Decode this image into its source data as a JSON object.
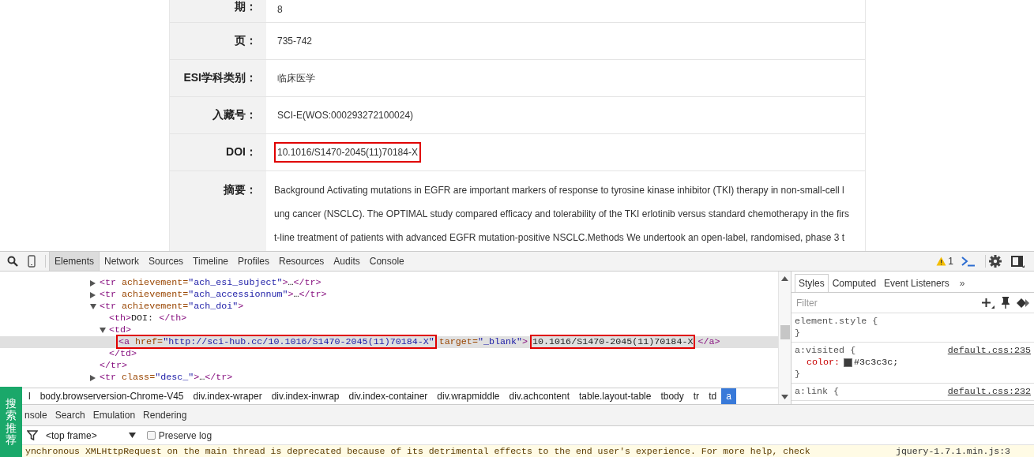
{
  "page": {
    "rows": [
      {
        "kind": "text",
        "label": "期：",
        "value": "8",
        "highlighted": false
      },
      {
        "kind": "text",
        "label": "页：",
        "value": "735-742",
        "highlighted": false
      },
      {
        "kind": "text",
        "label": "ESI学科类别：",
        "value": "临床医学",
        "highlighted": false
      },
      {
        "kind": "text",
        "label": "入藏号：",
        "value": "SCI-E(WOS:000293272100024)",
        "highlighted": false
      },
      {
        "kind": "text",
        "label": "DOI：",
        "value": "10.1016/S1470-2045(11)70184-X",
        "highlighted": true
      },
      {
        "kind": "paragraph",
        "label": "摘要：",
        "lines": [
          "Background Activating mutations in EGFR are important markers of response to tyrosine kinase inhibitor (TKI) therapy in non-small-cell l",
          "ung cancer (NSCLC). The OPTIMAL study compared efficacy and tolerability of the TKI erlotinib versus standard chemotherapy in the firs",
          "t-line treatment of patients with advanced EGFR mutation-positive NSCLC.Methods We undertook an open-label, randomised, phase 3 t"
        ]
      }
    ]
  },
  "devtools": {
    "tabs": [
      {
        "label": "Elements",
        "selected": true
      },
      {
        "label": "Network",
        "selected": false
      },
      {
        "label": "Sources",
        "selected": false
      },
      {
        "label": "Timeline",
        "selected": false
      },
      {
        "label": "Profiles",
        "selected": false
      },
      {
        "label": "Resources",
        "selected": false
      },
      {
        "label": "Audits",
        "selected": false
      },
      {
        "label": "Console",
        "selected": false
      }
    ],
    "warning_count": "1",
    "dom_tree": [
      {
        "selected": false,
        "expanded": false,
        "segments": [
          {
            "highlighted": false,
            "tokens": [
              {
                "kind": "tag",
                "text": "<tr "
              },
              {
                "kind": "attr",
                "text": "achievement="
              },
              {
                "kind": "value",
                "text": "\"ach_esi_subject\""
              },
              {
                "kind": "tag",
                "text": ">"
              },
              {
                "kind": "text",
                "text": "…"
              },
              {
                "kind": "tag",
                "text": "</tr>"
              }
            ]
          }
        ]
      },
      {
        "selected": false,
        "expanded": false,
        "segments": [
          {
            "highlighted": false,
            "tokens": [
              {
                "kind": "tag",
                "text": "<tr "
              },
              {
                "kind": "attr",
                "text": "achievement="
              },
              {
                "kind": "value",
                "text": "\"ach_accessionnum\""
              },
              {
                "kind": "tag",
                "text": ">"
              },
              {
                "kind": "text",
                "text": "…"
              },
              {
                "kind": "tag",
                "text": "</tr>"
              }
            ]
          }
        ]
      },
      {
        "selected": false,
        "expanded": true,
        "closing": "</tr>",
        "segments": [
          {
            "highlighted": false,
            "tokens": [
              {
                "kind": "tag",
                "text": "<tr "
              },
              {
                "kind": "attr",
                "text": "achievement="
              },
              {
                "kind": "value",
                "text": "\"ach_doi\""
              },
              {
                "kind": "tag",
                "text": ">"
              }
            ]
          }
        ],
        "children": [
          {
            "selected": false,
            "segments": [
              {
                "highlighted": false,
                "tokens": [
                  {
                    "kind": "tag",
                    "text": "<th>"
                  },
                  {
                    "kind": "text",
                    "text": "DOI: "
                  },
                  {
                    "kind": "tag",
                    "text": "</th>"
                  }
                ]
              }
            ]
          },
          {
            "selected": false,
            "expanded": true,
            "closing": "</td>",
            "segments": [
              {
                "highlighted": false,
                "tokens": [
                  {
                    "kind": "tag",
                    "text": "<td>"
                  }
                ]
              }
            ],
            "children": [
              {
                "selected": true,
                "segments": [
                  {
                    "highlighted": true,
                    "tokens": [
                      {
                        "kind": "tag",
                        "text": "<a "
                      },
                      {
                        "kind": "attr",
                        "text": "href="
                      },
                      {
                        "kind": "value",
                        "text": "\"http://sci-hub.cc/10.1016/S1470-2045(11)70184-X\""
                      }
                    ]
                  },
                  {
                    "highlighted": false,
                    "tokens": [
                      {
                        "kind": "attr",
                        "text": "target="
                      },
                      {
                        "kind": "value",
                        "text": "\"_blank\""
                      },
                      {
                        "kind": "tag",
                        "text": ">"
                      }
                    ]
                  },
                  {
                    "highlighted": true,
                    "tokens": [
                      {
                        "kind": "text",
                        "text": "10.1016/S1470-2045(11)70184-X"
                      }
                    ]
                  },
                  {
                    "highlighted": false,
                    "tokens": [
                      {
                        "kind": "tag",
                        "text": "</a>"
                      }
                    ]
                  }
                ]
              }
            ]
          }
        ]
      },
      {
        "selected": false,
        "expanded": false,
        "segments": [
          {
            "highlighted": false,
            "tokens": [
              {
                "kind": "tag",
                "text": "<tr "
              },
              {
                "kind": "attr",
                "text": "class="
              },
              {
                "kind": "value",
                "text": "\"desc_\""
              },
              {
                "kind": "tag",
                "text": ">"
              },
              {
                "kind": "text",
                "text": "…"
              },
              {
                "kind": "tag",
                "text": "</tr>"
              }
            ]
          }
        ]
      }
    ],
    "breadcrumbs": [
      {
        "label": "l",
        "selected": false
      },
      {
        "label": "body.browserversion-Chrome-V45",
        "selected": false
      },
      {
        "label": "div.index-wraper",
        "selected": false
      },
      {
        "label": "div.index-inwrap",
        "selected": false
      },
      {
        "label": "div.index-container",
        "selected": false
      },
      {
        "label": "div.wrapmiddle",
        "selected": false
      },
      {
        "label": "div.achcontent",
        "selected": false
      },
      {
        "label": "table.layout-table",
        "selected": false
      },
      {
        "label": "tbody",
        "selected": false
      },
      {
        "label": "tr",
        "selected": false
      },
      {
        "label": "td",
        "selected": false
      },
      {
        "label": "a",
        "selected": true
      }
    ],
    "styles": {
      "tabs": [
        {
          "label": "Styles",
          "selected": true
        },
        {
          "label": "Computed",
          "selected": false
        },
        {
          "label": "Event Listeners",
          "selected": false
        }
      ],
      "more": "»",
      "filter_placeholder": "Filter",
      "rules": [
        {
          "selector": "element.style {",
          "close": "}"
        },
        {
          "selector": "a:visited {",
          "source": "default.css:235",
          "close": "}",
          "properties": [
            {
              "name": "color:",
              "value": "#3c3c3c;",
              "color": "#3c3c3c"
            }
          ]
        },
        {
          "selector": "a:link {",
          "source": "default.css:232"
        }
      ]
    },
    "drawer_tabs": [
      {
        "label": "nsole",
        "selected": false
      },
      {
        "label": "Search",
        "selected": false
      },
      {
        "label": "Emulation",
        "selected": false
      },
      {
        "label": "Rendering",
        "selected": false
      }
    ],
    "frame_select": "<top frame>",
    "preserve_log": {
      "label": "Preserve log",
      "checked": false
    },
    "messages": [
      {
        "kind": "warning",
        "text": "ynchronous XMLHttpRequest on the main thread is deprecated because of its detrimental effects to the end user's experience. For more help, check",
        "source": "jquery-1.7.1.min.js:3"
      }
    ]
  },
  "side_widget": {
    "label": "搜索推荐"
  }
}
